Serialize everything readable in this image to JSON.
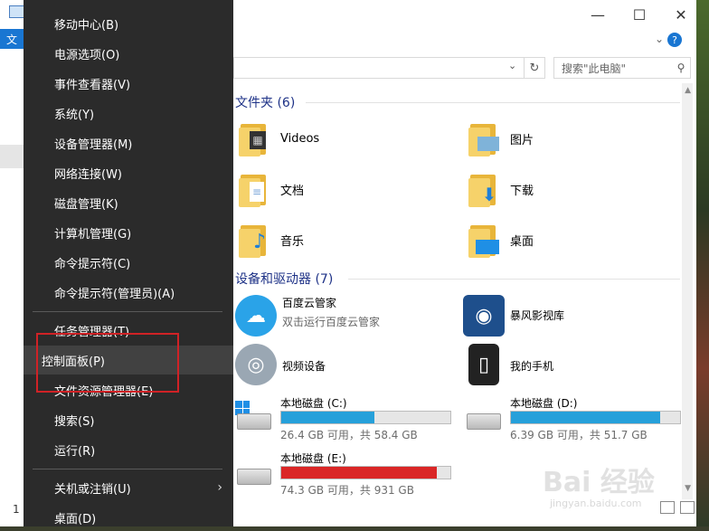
{
  "window": {
    "ribbon_tab": "文",
    "minimize": "—",
    "maximize": "☐",
    "close": "✕",
    "help": "?",
    "collapse": "⌄",
    "status_count": "1"
  },
  "address": {
    "search_placeholder": "搜索\"此电脑\"",
    "refresh": "↻",
    "dropdown": "⌄"
  },
  "sections": {
    "folders_header": "文件夹 (6)",
    "devices_header": "设备和驱动器 (7)"
  },
  "folders": [
    {
      "label": "Videos",
      "icon": "videos-folder-icon",
      "glyph": "▦"
    },
    {
      "label": "图片",
      "icon": "pictures-folder-icon",
      "glyph": "▭"
    },
    {
      "label": "文档",
      "icon": "documents-folder-icon",
      "glyph": "≡"
    },
    {
      "label": "下载",
      "icon": "downloads-folder-icon",
      "glyph": "⬇"
    },
    {
      "label": "音乐",
      "icon": "music-folder-icon",
      "glyph": "♪"
    },
    {
      "label": "桌面",
      "icon": "desktop-folder-icon",
      "glyph": "▬"
    }
  ],
  "devices": [
    {
      "name": "百度云管家",
      "sub": "双击运行百度云管家",
      "icon": "baidu-cloud-icon"
    },
    {
      "name": "暴风影视库",
      "sub": "",
      "icon": "baofeng-icon"
    },
    {
      "name": "视频设备",
      "sub": "",
      "icon": "webcam-icon"
    },
    {
      "name": "我的手机",
      "sub": "",
      "icon": "phone-icon"
    }
  ],
  "drives": [
    {
      "name": "本地磁盘 (C:)",
      "info": "26.4 GB 可用，共 58.4 GB",
      "used_fraction": 0.55,
      "color": "#26a0da"
    },
    {
      "name": "本地磁盘 (D:)",
      "info": "6.39 GB 可用，共 51.7 GB",
      "used_fraction": 0.88,
      "color": "#26a0da"
    },
    {
      "name": "本地磁盘 (E:)",
      "info": "74.3 GB 可用，共 931 GB",
      "used_fraction": 0.92,
      "color": "#da2626"
    }
  ],
  "menu": {
    "items": [
      {
        "label": "移动中心(B)"
      },
      {
        "label": "电源选项(O)"
      },
      {
        "label": "事件查看器(V)"
      },
      {
        "label": "系统(Y)"
      },
      {
        "label": "设备管理器(M)"
      },
      {
        "label": "网络连接(W)"
      },
      {
        "label": "磁盘管理(K)"
      },
      {
        "label": "计算机管理(G)"
      },
      {
        "label": "命令提示符(C)"
      },
      {
        "label": "命令提示符(管理员)(A)"
      },
      {
        "label": "任务管理器(T)"
      },
      {
        "label": "控制面板(P)"
      },
      {
        "label": "文件资源管理器(E)"
      },
      {
        "label": "搜索(S)"
      },
      {
        "label": "运行(R)"
      },
      {
        "label": "关机或注销(U)",
        "submenu_arrow": "›"
      },
      {
        "label": "桌面(D)"
      }
    ]
  },
  "watermark": {
    "text": "Bai 经验",
    "url": "jingyan.baidu.com"
  }
}
